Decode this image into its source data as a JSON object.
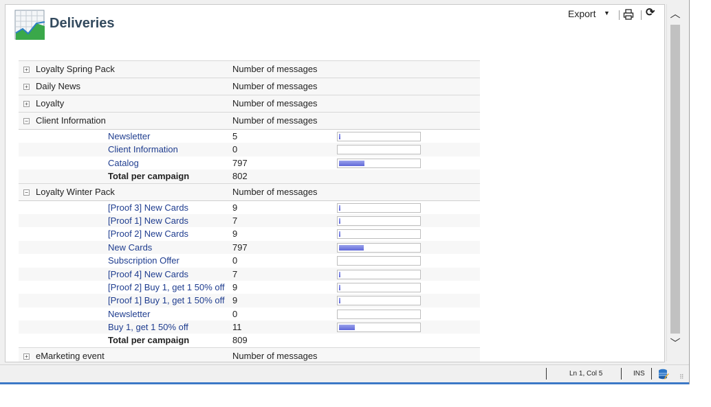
{
  "header": {
    "title": "Deliveries",
    "export_label": "Export",
    "logo_icon": "chart-logo-icon",
    "print_icon": "printer-icon",
    "refresh_icon": "refresh-icon"
  },
  "table": {
    "groups": [
      {
        "name": "Loyalty Spring Pack",
        "measure": "Number of messages",
        "expanded": false
      },
      {
        "name": "Daily News",
        "measure": "Number of messages",
        "expanded": false
      },
      {
        "name": "Loyalty",
        "measure": "Number of messages",
        "expanded": false
      },
      {
        "name": "Client Information",
        "measure": "Number of messages",
        "expanded": true,
        "rows": [
          {
            "label": "Newsletter",
            "value": "5",
            "bar": 0.006
          },
          {
            "label": "Client Information",
            "value": "0",
            "bar": 0
          },
          {
            "label": "Catalog",
            "value": "797",
            "bar": 0.32
          }
        ],
        "total": {
          "label": "Total per campaign",
          "value": "802"
        }
      },
      {
        "name": "Loyalty Winter Pack",
        "measure": "Number of messages",
        "expanded": true,
        "rows": [
          {
            "label": "[Proof 3] New Cards",
            "value": "9",
            "bar": 0.01
          },
          {
            "label": "[Proof 1] New Cards",
            "value": "7",
            "bar": 0.008
          },
          {
            "label": "[Proof 2] New Cards",
            "value": "9",
            "bar": 0.01
          },
          {
            "label": "New Cards",
            "value": "797",
            "bar": 0.31
          },
          {
            "label": "Subscription Offer",
            "value": "0",
            "bar": 0
          },
          {
            "label": "[Proof 4] New Cards",
            "value": "7",
            "bar": 0.008
          },
          {
            "label": "[Proof 2] Buy 1, get 1 50% off",
            "value": "9",
            "bar": 0.01
          },
          {
            "label": "[Proof 1] Buy 1, get 1 50% off",
            "value": "9",
            "bar": 0.01
          },
          {
            "label": "Newsletter",
            "value": "0",
            "bar": 0
          },
          {
            "label": "Buy 1, get 1 50% off",
            "value": "11",
            "bar": 0.2
          }
        ],
        "total": {
          "label": "Total per campaign",
          "value": "809"
        }
      },
      {
        "name": "eMarketing event",
        "measure": "Number of messages",
        "expanded": false
      }
    ]
  },
  "statusbar": {
    "position": "Ln 1, Col 5",
    "mode": "INS",
    "db_icon": "database-edit-icon"
  },
  "colors": {
    "title": "#334a5e",
    "link": "#1f3d8f",
    "bar_fill": "#7078dc",
    "accent_line": "#3b78c6"
  }
}
